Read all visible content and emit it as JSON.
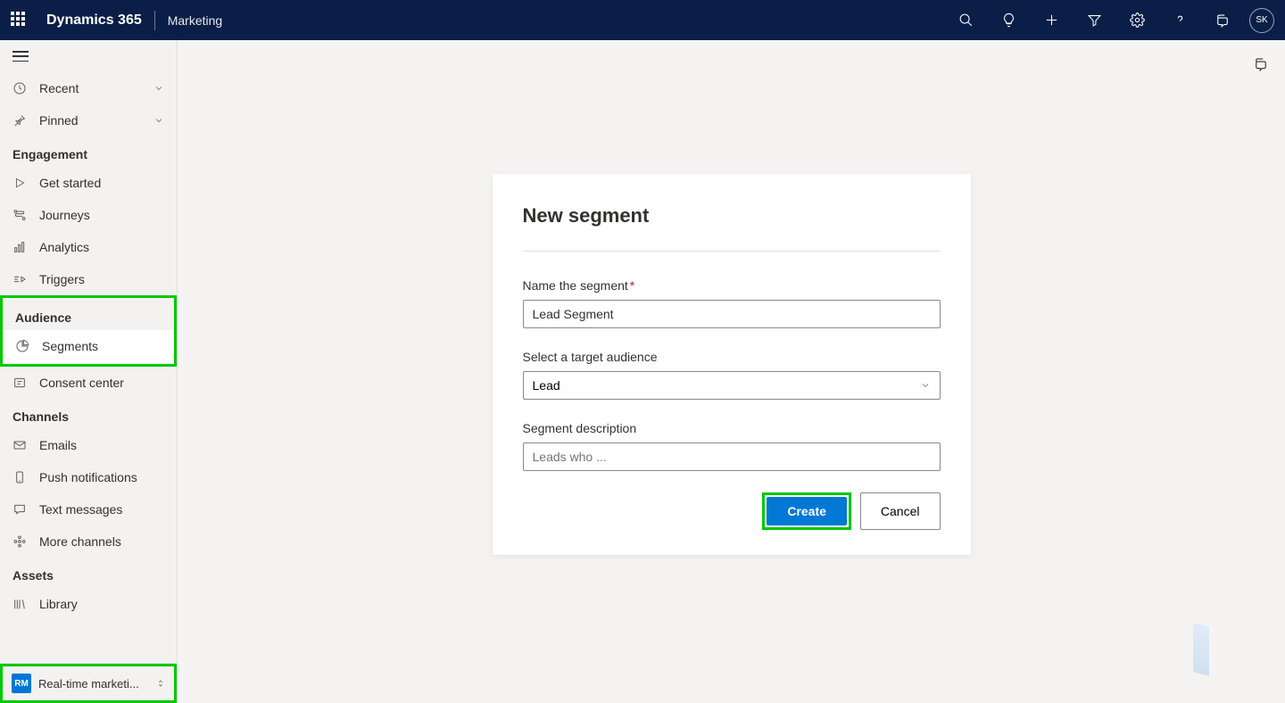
{
  "header": {
    "brand": "Dynamics 365",
    "module": "Marketing",
    "avatar": "SK"
  },
  "sidebar": {
    "recent": "Recent",
    "pinned": "Pinned",
    "groups": {
      "engagement": {
        "title": "Engagement",
        "items": [
          "Get started",
          "Journeys",
          "Analytics",
          "Triggers"
        ]
      },
      "audience": {
        "title": "Audience",
        "items": [
          "Segments",
          "Consent center"
        ]
      },
      "channels": {
        "title": "Channels",
        "items": [
          "Emails",
          "Push notifications",
          "Text messages",
          "More channels"
        ]
      },
      "assets": {
        "title": "Assets",
        "items": [
          "Library"
        ]
      }
    },
    "area": {
      "badge": "RM",
      "label": "Real-time marketi..."
    }
  },
  "dialog": {
    "title": "New segment",
    "nameLabel": "Name the segment",
    "nameValue": "Lead Segment",
    "audienceLabel": "Select a target audience",
    "audienceValue": "Lead",
    "descLabel": "Segment description",
    "descPlaceholder": "Leads who ...",
    "createBtn": "Create",
    "cancelBtn": "Cancel"
  }
}
